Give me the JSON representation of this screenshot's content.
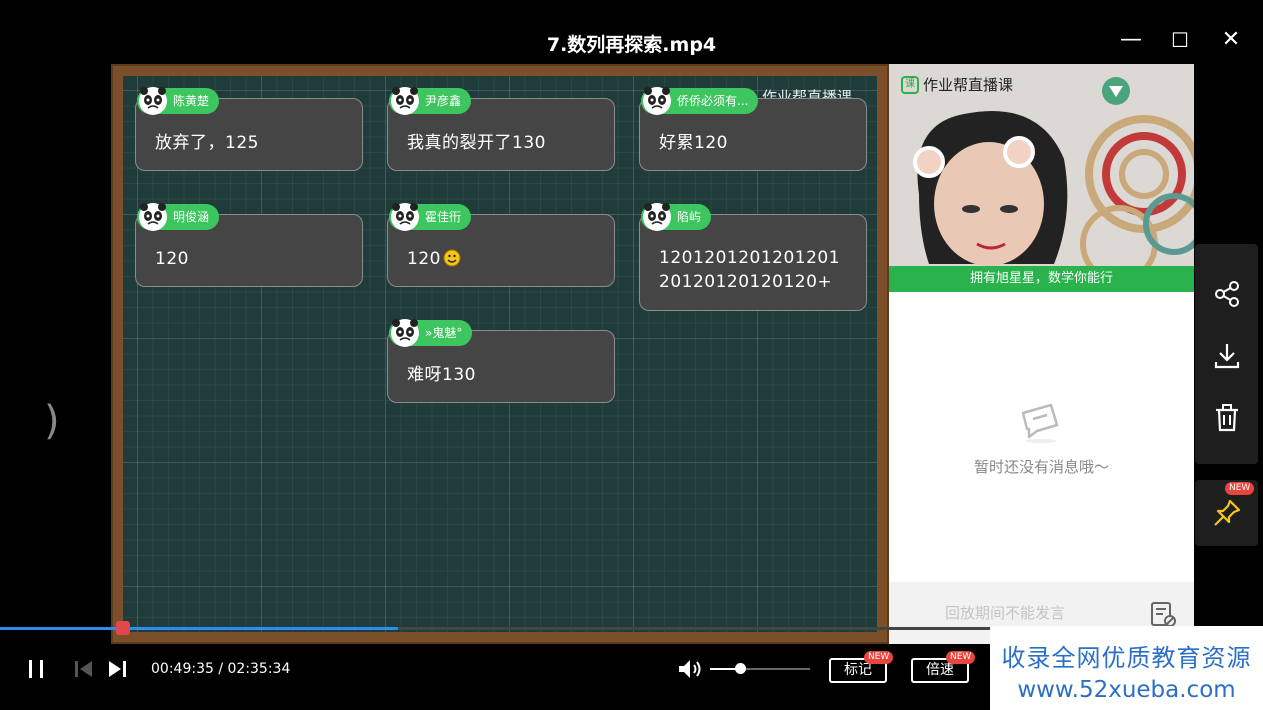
{
  "window": {
    "title": "7.数列再探索.mp4",
    "minimize": "—",
    "maximize": "☐",
    "close": "✕"
  },
  "board": {
    "watermark": "作业帮直播课",
    "cards": [
      {
        "user": "陈黄楚",
        "text": "放弃了，125"
      },
      {
        "user": "尹彦鑫",
        "text": "我真的裂开了130"
      },
      {
        "user": "侨侨必须有...",
        "text": "好累120"
      },
      {
        "user": "明俊涵",
        "text": "120"
      },
      {
        "user": "霍佳衎",
        "text": "120"
      },
      {
        "user": "陷屿",
        "text": "1201201201201201\n20120120120120+"
      },
      {
        "user": "»鬼魅°",
        "text": "难呀130"
      }
    ]
  },
  "side_panel": {
    "logo": "作业帮直播课",
    "logo_mark": "课",
    "banner": "拥有旭星星，数学你能行",
    "empty_message": "暂时还没有消息哦～",
    "footer_text": "回放期间不能发言"
  },
  "toolbar": {
    "share_icon": "share-icon",
    "download_icon": "download-icon",
    "delete_icon": "trash-icon",
    "pin_icon": "pin-icon",
    "pin_badge": "NEW"
  },
  "player": {
    "current_time": "00:49:35",
    "total_time": "02:35:34",
    "time_display": "00:49:35 / 02:35:34",
    "progress_fraction": 0.319,
    "volume_fraction": 0.3,
    "mark_button": "标记",
    "speed_button": "倍速",
    "mark_badge": "NEW",
    "speed_badge": "NEW"
  },
  "watermark": {
    "line1": "收录全网优质教育资源",
    "line2": "www.52xueba.com"
  },
  "colors": {
    "accent_green": "#3dc55f",
    "progress_blue": "#2d8cf0",
    "badge_red": "#e8453c",
    "watermark_blue": "#2b6fc7"
  }
}
